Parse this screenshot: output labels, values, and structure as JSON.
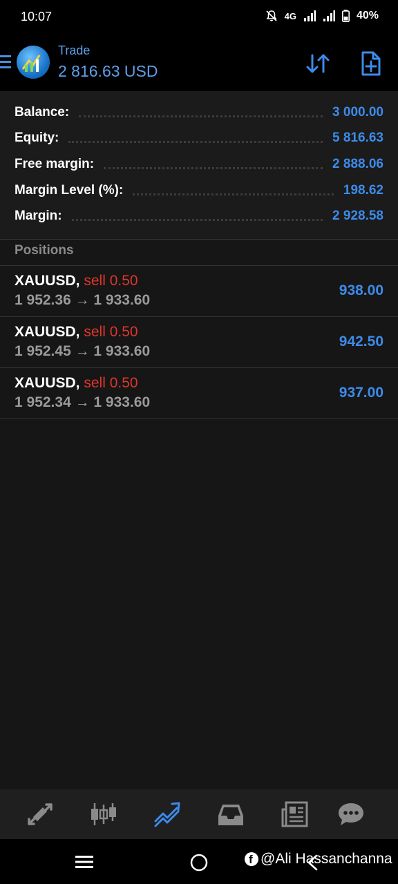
{
  "status_bar": {
    "time": "10:07",
    "network": "4G",
    "battery": "40%"
  },
  "header": {
    "title": "Trade",
    "balance": "2 816.63 USD",
    "icons": [
      "menu-icon",
      "sort-icon",
      "new-order-icon"
    ],
    "accent_color": "#5d9fe8"
  },
  "summary": {
    "rows": [
      {
        "label": "Balance:",
        "value": "3 000.00"
      },
      {
        "label": "Equity:",
        "value": "5 816.63"
      },
      {
        "label": "Free margin:",
        "value": "2 888.06"
      },
      {
        "label": "Margin Level (%):",
        "value": "198.62"
      },
      {
        "label": "Margin:",
        "value": "2 928.58"
      }
    ]
  },
  "positions": {
    "heading": "Positions",
    "items": [
      {
        "symbol": "XAUUSD,",
        "side": "sell 0.50",
        "prices": "1 952.36 → 1 933.60",
        "profit": "938.00"
      },
      {
        "symbol": "XAUUSD,",
        "side": "sell 0.50",
        "prices": "1 952.45 → 1 933.60",
        "profit": "942.50"
      },
      {
        "symbol": "XAUUSD,",
        "side": "sell 0.50",
        "prices": "1 952.34 → 1 933.60",
        "profit": "937.00"
      }
    ]
  },
  "bottom_nav": {
    "items": [
      "quotes-icon",
      "chart-icon",
      "trade-icon",
      "history-icon",
      "news-icon",
      "messages-icon"
    ],
    "active": "trade-icon",
    "active_color": "#3d8bea"
  },
  "watermark": {
    "text": "@Ali Hassanchanna"
  }
}
